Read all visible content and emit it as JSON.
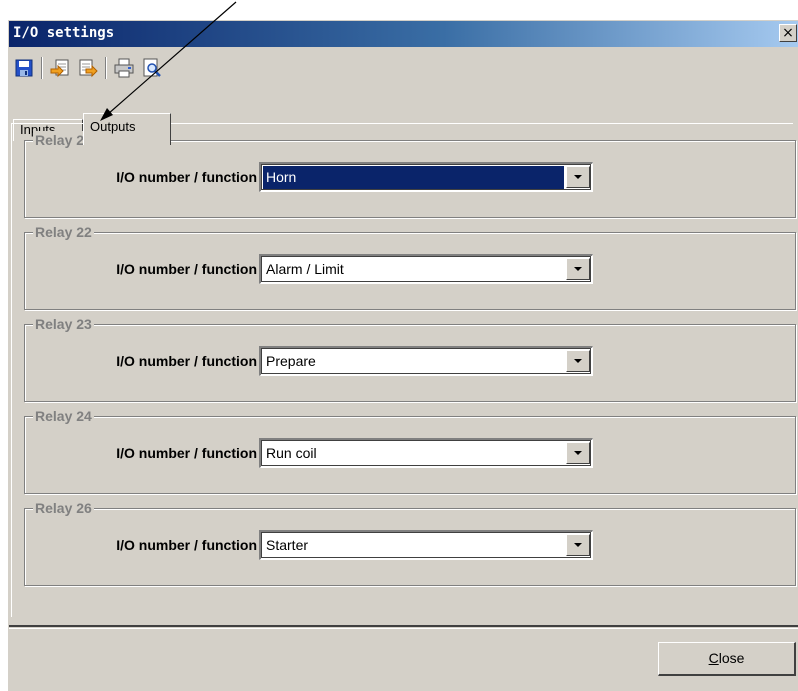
{
  "window": {
    "title": "I/O settings",
    "close_glyph": "×"
  },
  "toolbar": {
    "buttons": [
      {
        "name": "save-icon"
      },
      {
        "name": "import-icon"
      },
      {
        "name": "export-icon"
      },
      {
        "name": "print-icon"
      },
      {
        "name": "print-preview-icon"
      }
    ]
  },
  "tabs": [
    {
      "label": "Inputs",
      "active": false
    },
    {
      "label": "Outputs",
      "active": true
    }
  ],
  "relays": [
    {
      "title": "Relay 21",
      "label": "I/O number / function",
      "value": "Horn",
      "selected": true
    },
    {
      "title": "Relay 22",
      "label": "I/O number / function",
      "value": "Alarm / Limit",
      "selected": false
    },
    {
      "title": "Relay 23",
      "label": "I/O number / function",
      "value": "Prepare",
      "selected": false
    },
    {
      "title": "Relay 24",
      "label": "I/O number / function",
      "value": "Run coil",
      "selected": false
    },
    {
      "title": "Relay 26",
      "label": "I/O number / function",
      "value": "Starter",
      "selected": false
    }
  ],
  "footer": {
    "close_label_first": "C",
    "close_label_rest": "lose"
  },
  "colors": {
    "selection": "#0a246a",
    "face": "#d4d0c8",
    "group_title": "#808080"
  }
}
